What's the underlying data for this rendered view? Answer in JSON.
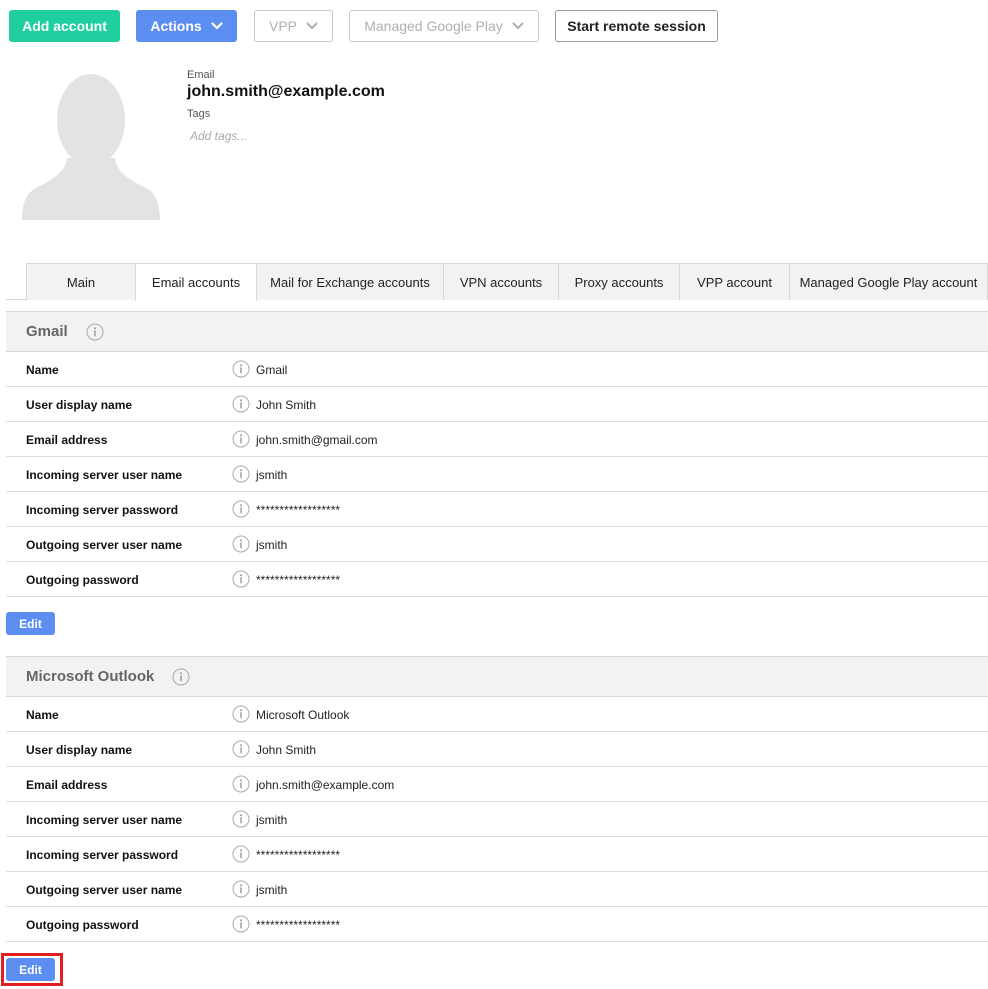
{
  "toolbar": {
    "add_account": "Add account",
    "actions": "Actions",
    "vpp": "VPP",
    "managed_google_play": "Managed Google Play",
    "start_remote_session": "Start remote session"
  },
  "profile": {
    "email_label": "Email",
    "email_value": "john.smith@example.com",
    "tags_label": "Tags",
    "tags_placeholder": "Add tags..."
  },
  "tabs": [
    {
      "label": "Main"
    },
    {
      "label": "Email accounts"
    },
    {
      "label": "Mail for Exchange accounts"
    },
    {
      "label": "VPN accounts"
    },
    {
      "label": "Proxy accounts"
    },
    {
      "label": "VPP account"
    },
    {
      "label": "Managed Google Play account"
    }
  ],
  "active_tab": "Email accounts",
  "accounts": [
    {
      "title": "Gmail",
      "edit_label": "Edit",
      "rows": [
        {
          "label": "Name",
          "value": "Gmail"
        },
        {
          "label": "User display name",
          "value": "John Smith"
        },
        {
          "label": "Email address",
          "value": "john.smith@gmail.com"
        },
        {
          "label": "Incoming server user name",
          "value": "jsmith"
        },
        {
          "label": "Incoming server password",
          "value": "******************"
        },
        {
          "label": "Outgoing server user name",
          "value": "jsmith"
        },
        {
          "label": "Outgoing password",
          "value": "******************"
        }
      ]
    },
    {
      "title": "Microsoft Outlook",
      "edit_label": "Edit",
      "rows": [
        {
          "label": "Name",
          "value": "Microsoft Outlook"
        },
        {
          "label": "User display name",
          "value": "John Smith"
        },
        {
          "label": "Email address",
          "value": "john.smith@example.com"
        },
        {
          "label": "Incoming server user name",
          "value": "jsmith"
        },
        {
          "label": "Incoming server password",
          "value": "******************"
        },
        {
          "label": "Outgoing server user name",
          "value": "jsmith"
        },
        {
          "label": "Outgoing password",
          "value": "******************"
        }
      ]
    }
  ],
  "colors": {
    "green": "#1fcf9f",
    "blue": "#5c8ef2",
    "highlight": "#e02020"
  }
}
